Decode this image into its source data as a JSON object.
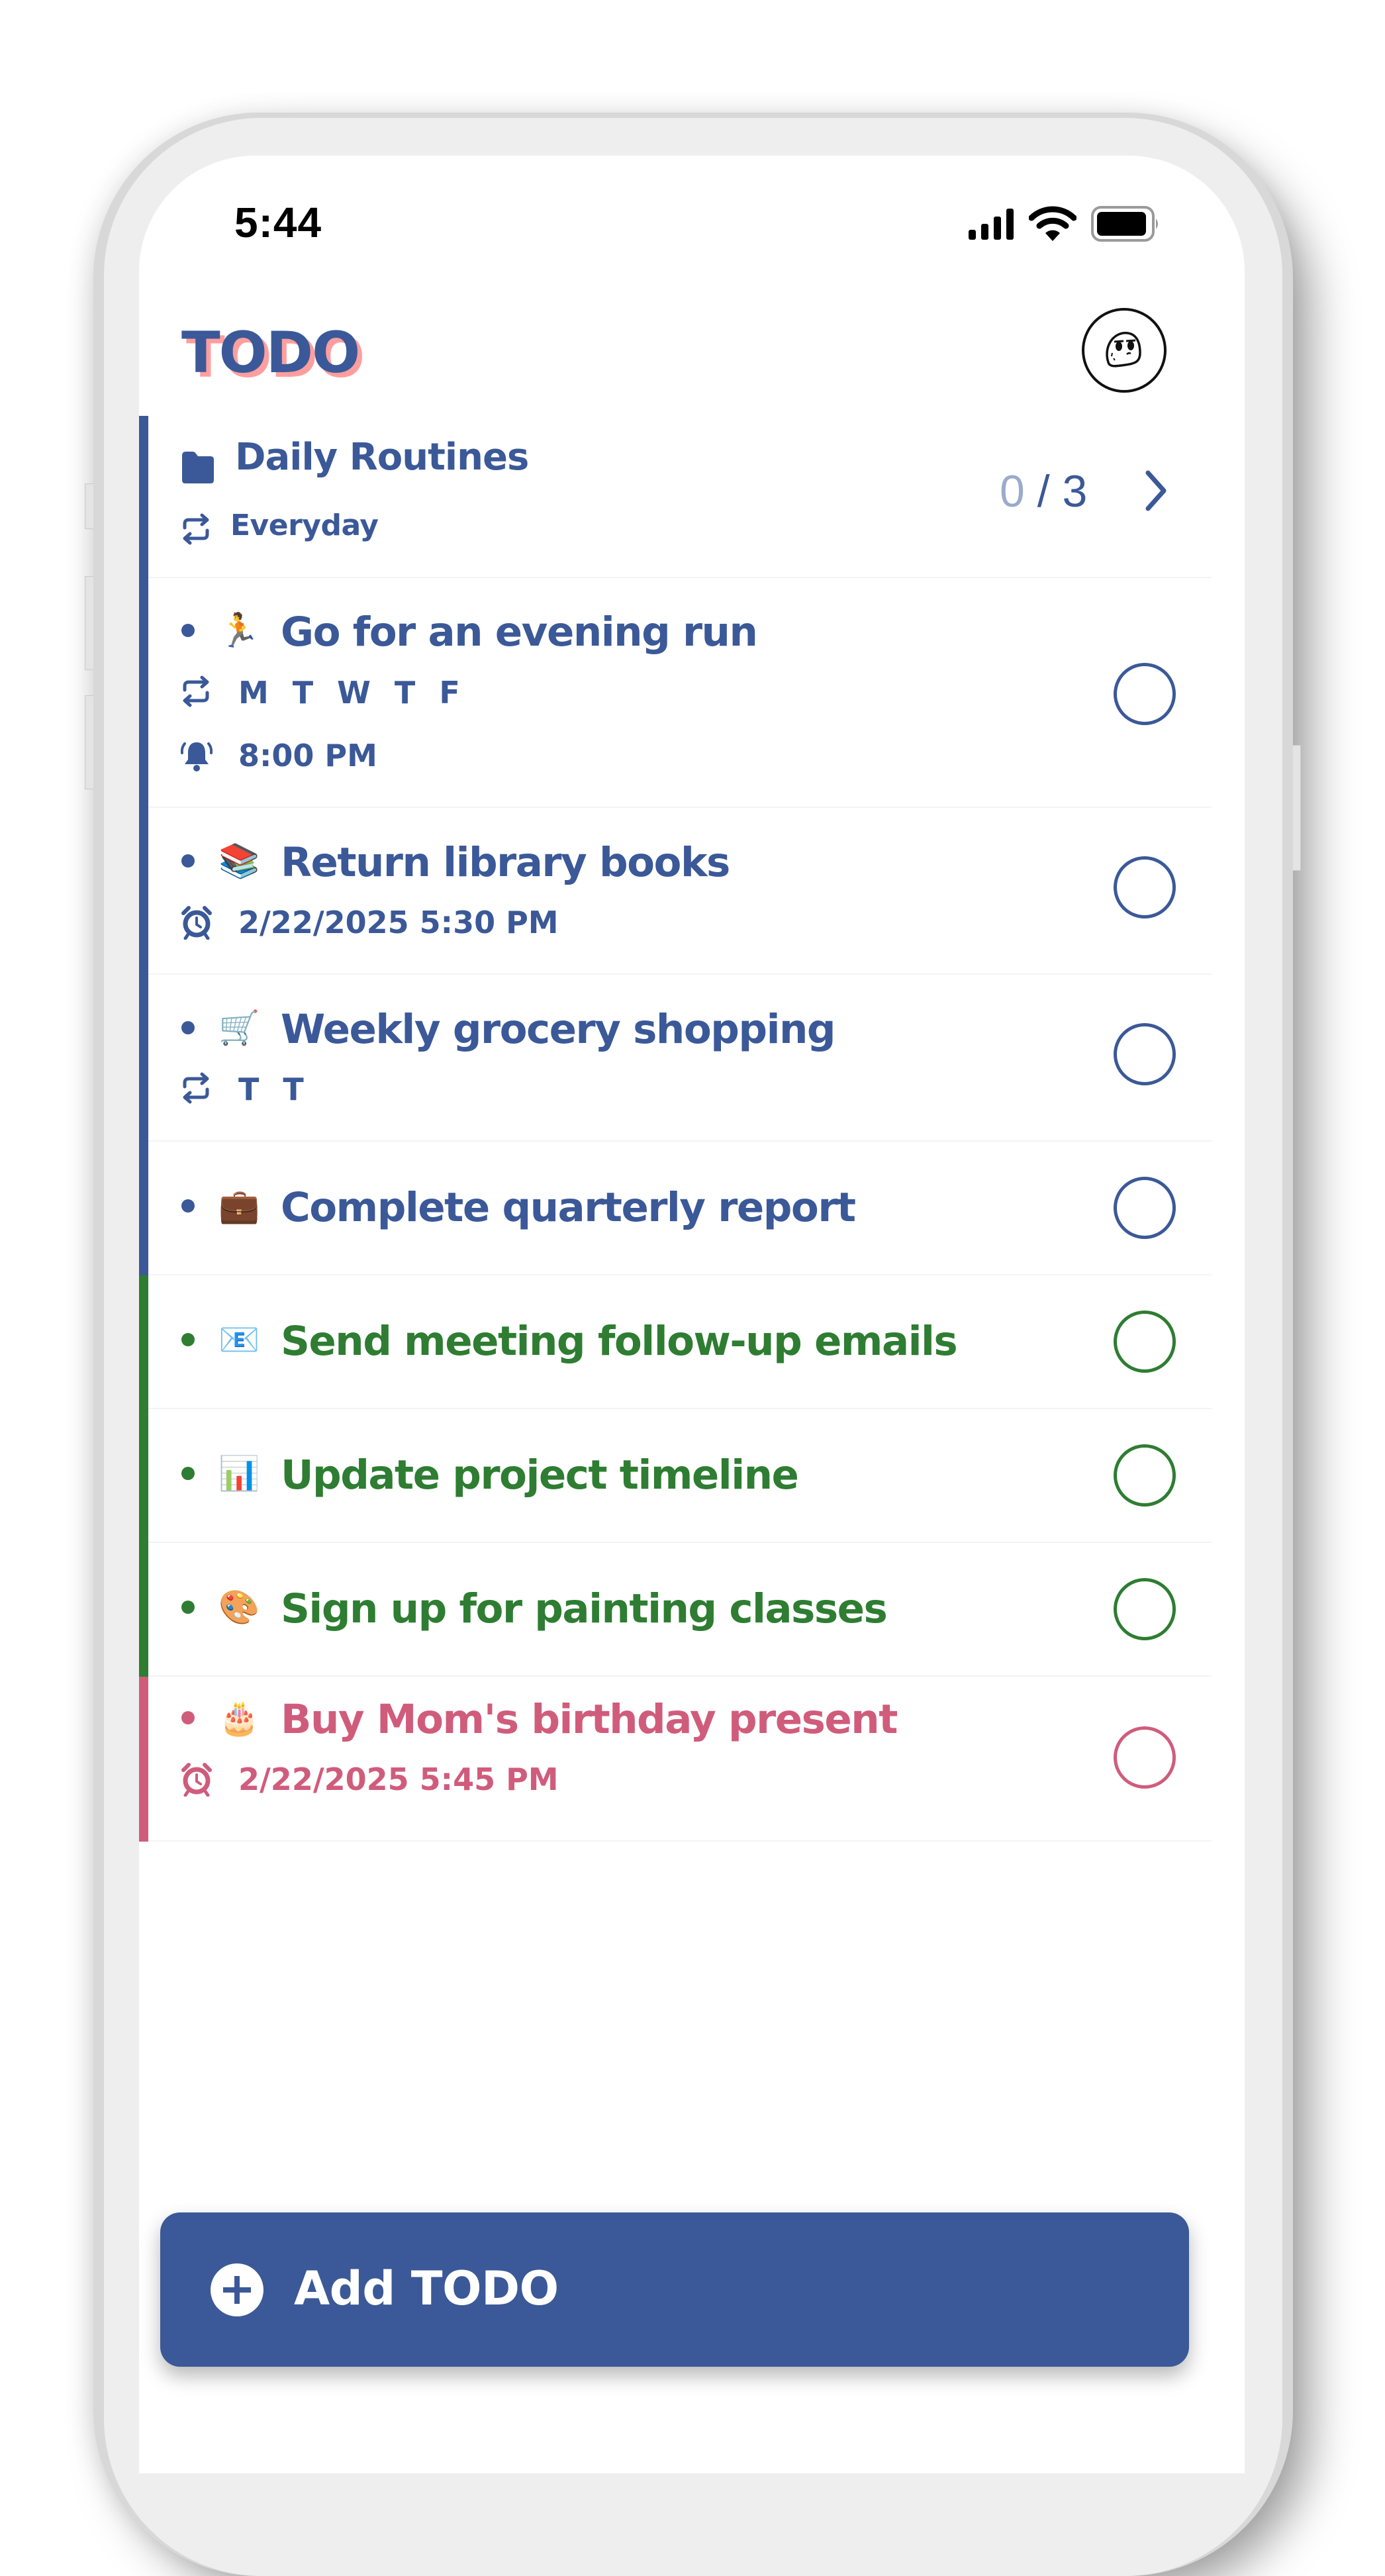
{
  "status_bar": {
    "time": "5:44",
    "icons": [
      "cellular-signal-icon",
      "wifi-icon",
      "battery-icon"
    ],
    "battery_level": 0.9
  },
  "header": {
    "title": "TODO",
    "avatar_icon": "cartoon-face-avatar"
  },
  "colors": {
    "primary_blue": "#3b5998",
    "green": "#2e7d32",
    "pink": "#d05c7c",
    "title_shadow": "#ff9e9e",
    "count_done": "#9aabcc"
  },
  "group": {
    "icon": "folder-icon",
    "name": "Daily Routines",
    "schedule_icon": "repeat-icon",
    "schedule": "Everyday",
    "count_done": "0",
    "count_sep": " / ",
    "count_total": "3",
    "chevron_icon": "chevron-right-icon"
  },
  "tasks": [
    {
      "emoji": "🏃",
      "title": "Go for an evening run",
      "color": "green_off",
      "meta": [
        {
          "icon": "repeat-icon",
          "text": "M T W T F",
          "kind": "days"
        },
        {
          "icon": "bell-icon",
          "text": "8:00 PM",
          "kind": "time"
        }
      ]
    },
    {
      "emoji": "📚",
      "title": "Return library books",
      "meta": [
        {
          "icon": "alarm-clock-icon",
          "text": "2/22/2025 5:30 PM",
          "kind": "time"
        }
      ]
    },
    {
      "emoji": "🛒",
      "title": "Weekly grocery shopping",
      "meta": [
        {
          "icon": "repeat-icon",
          "text": "T T",
          "kind": "days"
        }
      ]
    },
    {
      "emoji": "💼",
      "title": "Complete quarterly report",
      "meta": []
    },
    {
      "emoji": "📧",
      "title": "Send meeting follow-up emails",
      "meta": []
    },
    {
      "emoji": "📊",
      "title": "Update project timeline",
      "meta": []
    },
    {
      "emoji": "🎨",
      "title": "Sign up for painting classes",
      "meta": []
    },
    {
      "emoji": "🎂",
      "title": "Buy Mom's birthday present",
      "meta": [
        {
          "icon": "alarm-clock-icon",
          "text": "2/22/2025 5:45 PM",
          "kind": "time"
        }
      ]
    }
  ],
  "add_button": {
    "icon": "plus-circle-icon",
    "label": "Add TODO"
  }
}
